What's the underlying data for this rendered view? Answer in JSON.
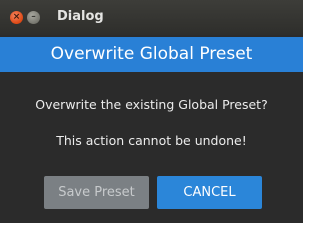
{
  "window": {
    "title": "Dialog",
    "close_glyph": "×",
    "minimize_glyph": "–"
  },
  "dialog": {
    "header": "Overwrite Global Preset",
    "message_line1": "Overwrite the existing Global Preset?",
    "message_line2": "This action cannot be undone!"
  },
  "buttons": {
    "save_label": "Save Preset",
    "cancel_label": "CANCEL"
  },
  "colors": {
    "accent": "#2980d6",
    "background": "#2b2b2b",
    "close_button": "#dd4814",
    "disabled_button": "#7b8084"
  }
}
